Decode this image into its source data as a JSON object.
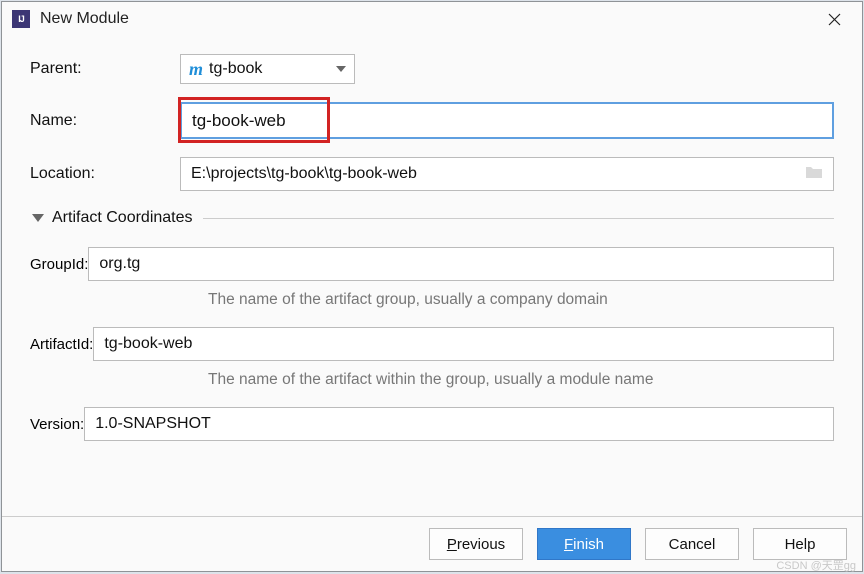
{
  "titlebar": {
    "title": "New Module"
  },
  "form": {
    "parent_label": "Parent:",
    "parent_value": "tg-book",
    "name_label": "Name:",
    "name_value": "tg-book-web",
    "location_label": "Location:",
    "location_value": "E:\\projects\\tg-book\\tg-book-web"
  },
  "section": {
    "title": "Artifact Coordinates"
  },
  "artifact": {
    "groupid_label": "GroupId:",
    "groupid_value": "org.tg",
    "groupid_hint": "The name of the artifact group, usually a company domain",
    "artifactid_label": "ArtifactId:",
    "artifactid_value": "tg-book-web",
    "artifactid_hint": "The name of the artifact within the group, usually a module name",
    "version_label": "Version:",
    "version_value": "1.0-SNAPSHOT"
  },
  "buttons": {
    "previous": "Previous",
    "previous_m": "P",
    "finish": "Finish",
    "finish_m": "F",
    "cancel": "Cancel",
    "help": "Help"
  },
  "watermark": "CSDN @天罡gg"
}
